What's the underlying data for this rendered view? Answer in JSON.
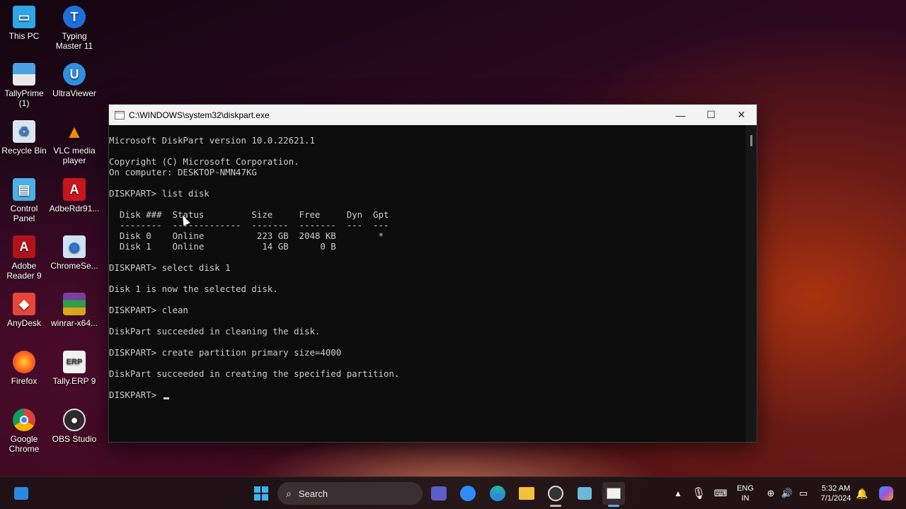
{
  "desktop": {
    "icons": [
      {
        "label": "This PC",
        "icon": "monitor-icon"
      },
      {
        "label": "Typing Master 11",
        "icon": "typing-master-icon"
      },
      {
        "label": "TallyPrime (1)",
        "icon": "tallyprime-icon"
      },
      {
        "label": "UltraViewer",
        "icon": "ultraviewer-icon"
      },
      {
        "label": "Recycle Bin",
        "icon": "recycle-bin-icon"
      },
      {
        "label": "VLC media player",
        "icon": "vlc-icon"
      },
      {
        "label": "Control Panel",
        "icon": "control-panel-icon"
      },
      {
        "label": "AdbeRdr91...",
        "icon": "pdf-installer-icon"
      },
      {
        "label": "Adobe Reader 9",
        "icon": "adobe-reader-icon"
      },
      {
        "label": "ChromeSe...",
        "icon": "chrome-setup-icon"
      },
      {
        "label": "AnyDesk",
        "icon": "anydesk-icon"
      },
      {
        "label": "winrar-x64...",
        "icon": "winrar-icon"
      },
      {
        "label": "Firefox",
        "icon": "firefox-icon"
      },
      {
        "label": "Tally.ERP 9",
        "icon": "tally-erp-icon"
      },
      {
        "label": "Google Chrome",
        "icon": "chrome-icon"
      },
      {
        "label": "OBS Studio",
        "icon": "obs-icon"
      }
    ]
  },
  "window": {
    "title": "C:\\WINDOWS\\system32\\diskpart.exe",
    "minimize": "—",
    "maximize": "☐",
    "close": "✕"
  },
  "console": {
    "lines": [
      "Microsoft DiskPart version 10.0.22621.1",
      "",
      "Copyright (C) Microsoft Corporation.",
      "On computer: DESKTOP-NMN47KG",
      "",
      "DISKPART> list disk",
      "",
      "  Disk ###  Status         Size     Free     Dyn  Gpt",
      "  --------  -------------  -------  -------  ---  ---",
      "  Disk 0    Online          223 GB  2048 KB        *",
      "  Disk 1    Online           14 GB      0 B",
      "",
      "DISKPART> select disk 1",
      "",
      "Disk 1 is now the selected disk.",
      "",
      "DISKPART> clean",
      "",
      "DiskPart succeeded in cleaning the disk.",
      "",
      "DISKPART> create partition primary size=4000",
      "",
      "DiskPart succeeded in creating the specified partition.",
      "",
      "DISKPART> "
    ]
  },
  "taskbar": {
    "search_placeholder": "Search",
    "language": "ENG",
    "region": "IN",
    "time": "5:32 AM",
    "date": "7/1/2024"
  },
  "colors": {
    "console_bg": "#0c0c0c",
    "console_text": "#cccccc",
    "titlebar_bg": "#f3f3f3"
  }
}
